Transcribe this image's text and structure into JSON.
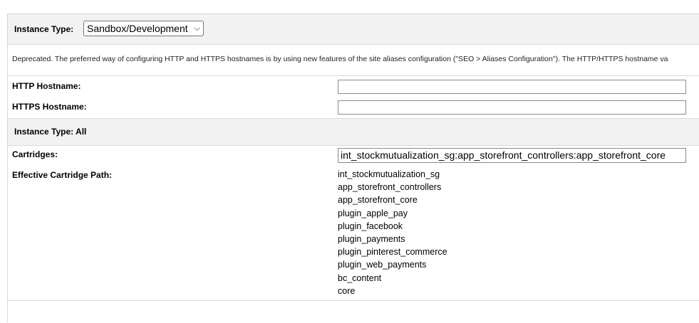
{
  "instance_section": {
    "label": "Instance Type:",
    "selected_value": "Sandbox/Development",
    "chevron_icon": "chevron-down-icon"
  },
  "description": "Deprecated. The preferred way of configuring HTTP and HTTPS hostnames is by using new features of the site aliases configuration (\"SEO > Aliases Configuration\"). The HTTP/HTTPS hostname va",
  "fields": {
    "http_label": "HTTP Hostname:",
    "http_value": "",
    "https_label": "HTTPS Hostname:",
    "https_value": ""
  },
  "all_section": {
    "label": "Instance Type:",
    "value": "All"
  },
  "cartridges": {
    "label": "Cartridges:",
    "value": "int_stockmutualization_sg:app_storefront_controllers:app_storefront_core"
  },
  "effective_path": {
    "label": "Effective Cartridge Path:",
    "items": [
      "int_stockmutualization_sg",
      "app_storefront_controllers",
      "app_storefront_core",
      "plugin_apple_pay",
      "plugin_facebook",
      "plugin_payments",
      "plugin_pinterest_commerce",
      "plugin_web_payments",
      "bc_content",
      "core"
    ]
  }
}
